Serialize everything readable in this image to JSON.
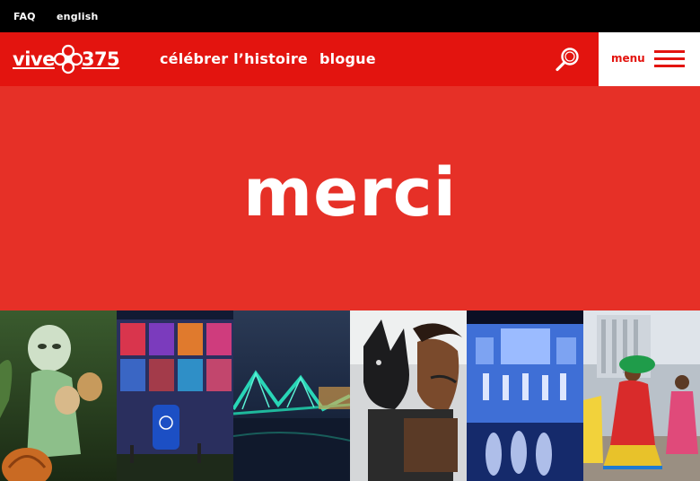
{
  "topbar": {
    "faq": "FAQ",
    "language": "english"
  },
  "navbar": {
    "logo": {
      "left": "vive",
      "right": "375",
      "icon": "montreal-flower-icon"
    },
    "links": [
      "célébrer l’histoire",
      "blogue"
    ],
    "search_icon": "search-icon",
    "menu_label": "menu",
    "menu_icon": "hamburger-icon"
  },
  "hero": {
    "title": "merci"
  },
  "gallery": {
    "tiles": [
      "lantern-figures-photo",
      "illuminated-building-photo",
      "lit-bridge-photo",
      "puppet-dog-performer-photo",
      "projection-show-photo",
      "parade-dancers-photo"
    ]
  },
  "colors": {
    "brand_red": "#e3140f",
    "hero_red": "#e63027",
    "topbar": "#000000",
    "white": "#ffffff"
  }
}
